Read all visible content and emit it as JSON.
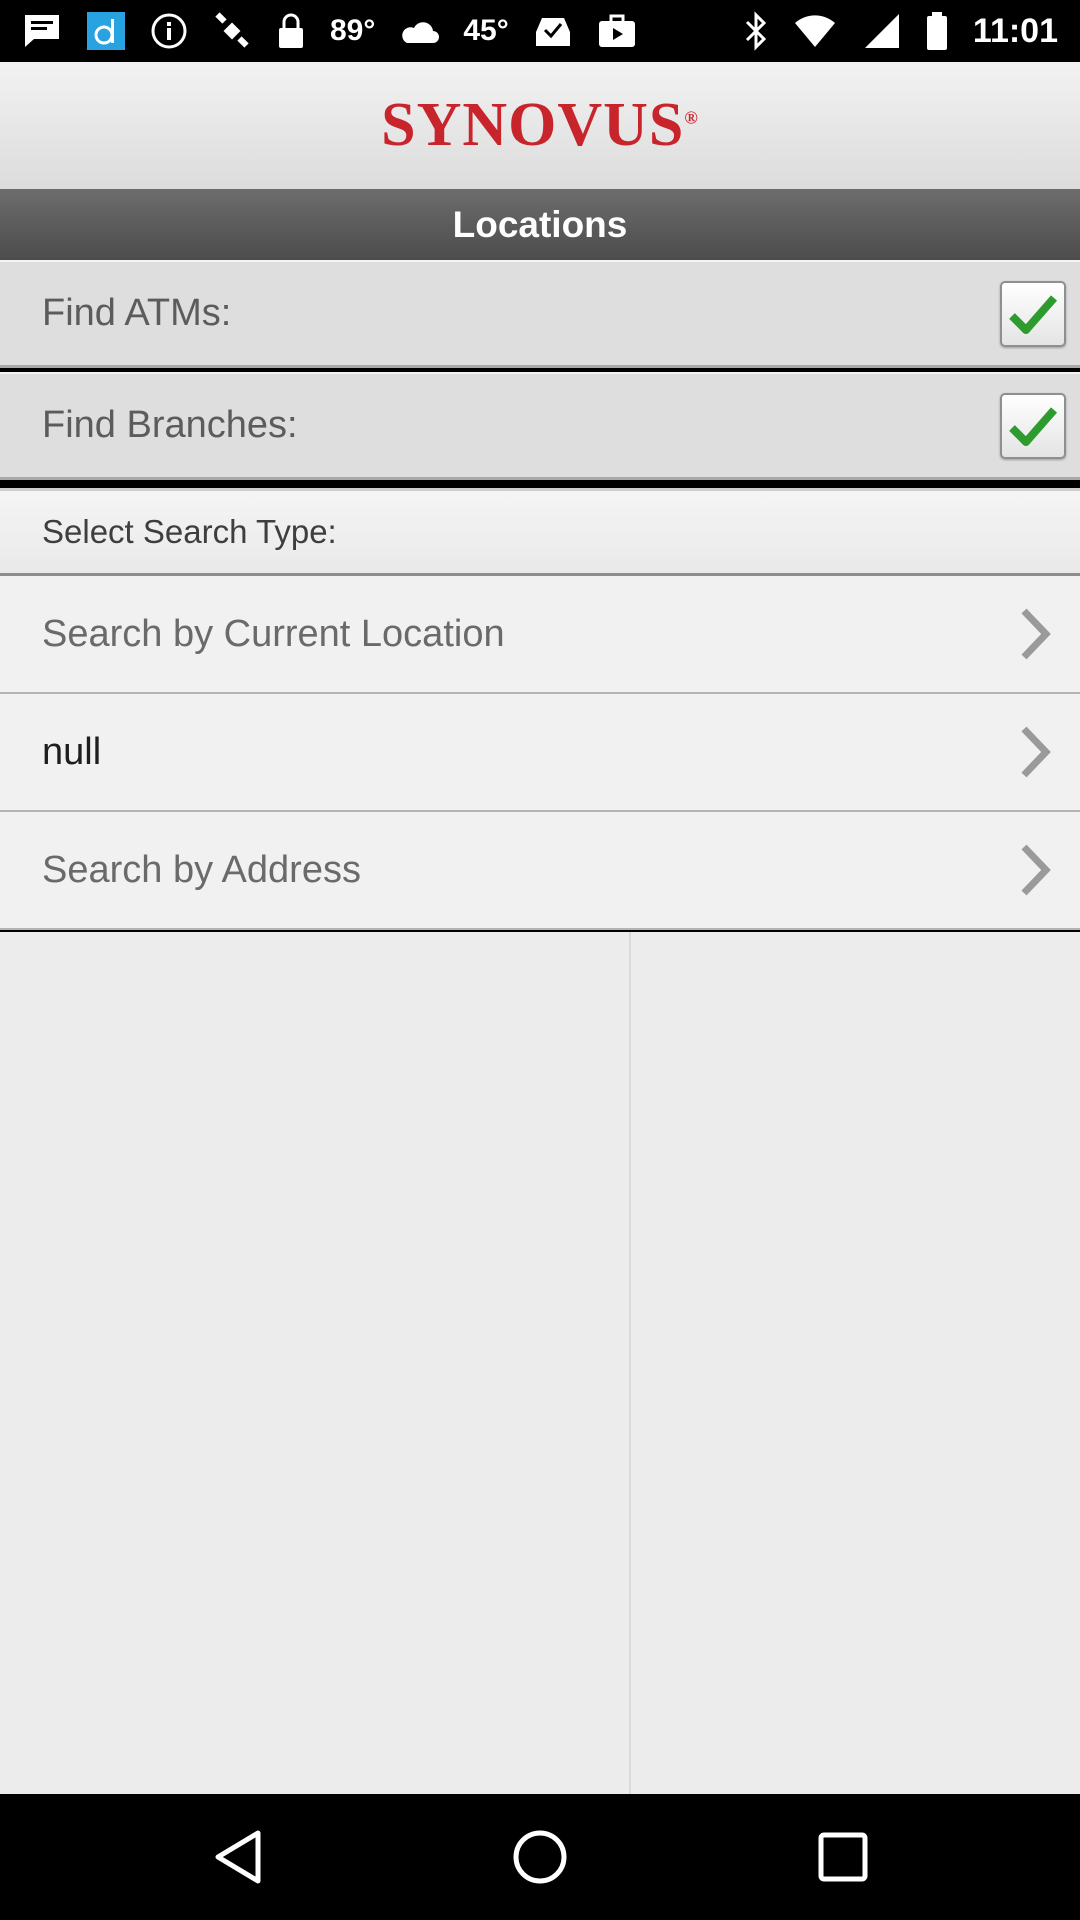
{
  "status_bar": {
    "icons_left": [
      "message-icon",
      "app-d-icon",
      "info-icon",
      "satellite-icon",
      "lock-icon"
    ],
    "temp_1": "89°",
    "temp_2": "45°",
    "icons_after": [
      "inbox-check-icon",
      "briefcase-icon"
    ],
    "bluetooth": "bluetooth-icon",
    "time": "11:01"
  },
  "header": {
    "brand": "SYNOVUS",
    "brand_color": "#c8242b"
  },
  "title_bar": {
    "title": "Locations"
  },
  "filters": [
    {
      "label": "Find ATMs:",
      "checked": true
    },
    {
      "label": "Find Branches:",
      "checked": true
    }
  ],
  "search_section": {
    "header": "Select Search Type:",
    "items": [
      {
        "label": "Search by Current Location"
      },
      {
        "label": "null"
      },
      {
        "label": "Search by Address"
      }
    ]
  },
  "colors": {
    "check_green": "#2e9b2e"
  },
  "nav_bar": {
    "buttons": [
      "back-icon",
      "home-icon",
      "recents-icon"
    ]
  }
}
